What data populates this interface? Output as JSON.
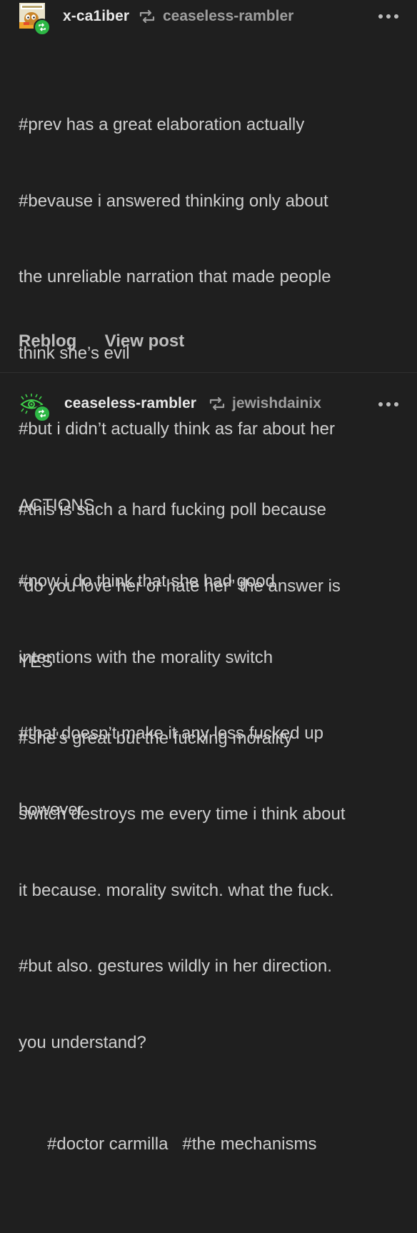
{
  "post1": {
    "username": "x-ca1iber",
    "reblogged_from": "ceaseless-rambler",
    "more_icon": "more-dots-icon",
    "avatar_icon": "cartoon-dog-avatar",
    "badge_icon": "reblog-badge-icon",
    "body_lines": [
      "#prev has a great elaboration actually",
      "#bevause i answered thinking only about",
      "the unreliable narration that made people",
      "think she’s evil",
      "#but i didn’t actually think as far about her",
      "ACTIONS",
      "#now i do think that she had good",
      "intentions with the morality switch",
      "#that doesn’t make it any less fucked up",
      "however"
    ],
    "actions": {
      "reblog_label": "Reblog",
      "view_post_label": "View post"
    }
  },
  "post2": {
    "username": "ceaseless-rambler",
    "reblogged_from": "jewishdainix",
    "more_icon": "more-dots-icon",
    "avatar_icon": "green-eye-avatar",
    "badge_icon": "reblog-badge-icon",
    "body_lines": [
      "#this is such a hard fucking poll because",
      "“do you love her or hate her” the answer is",
      "YES",
      "#she's great but the fucking morality",
      "switch destroys me every time i think about",
      "it because. morality switch. what the fuck.",
      "#but also. gestures wildly in her direction.",
      "you understand?"
    ],
    "tags": [
      "#doctor carmilla",
      "#the mechanisms"
    ]
  },
  "colors": {
    "background": "#1f1f1f",
    "text": "#cfcfcf",
    "username": "#e8e8e8",
    "muted": "#9e9e9e",
    "badge_green": "#2db745"
  }
}
